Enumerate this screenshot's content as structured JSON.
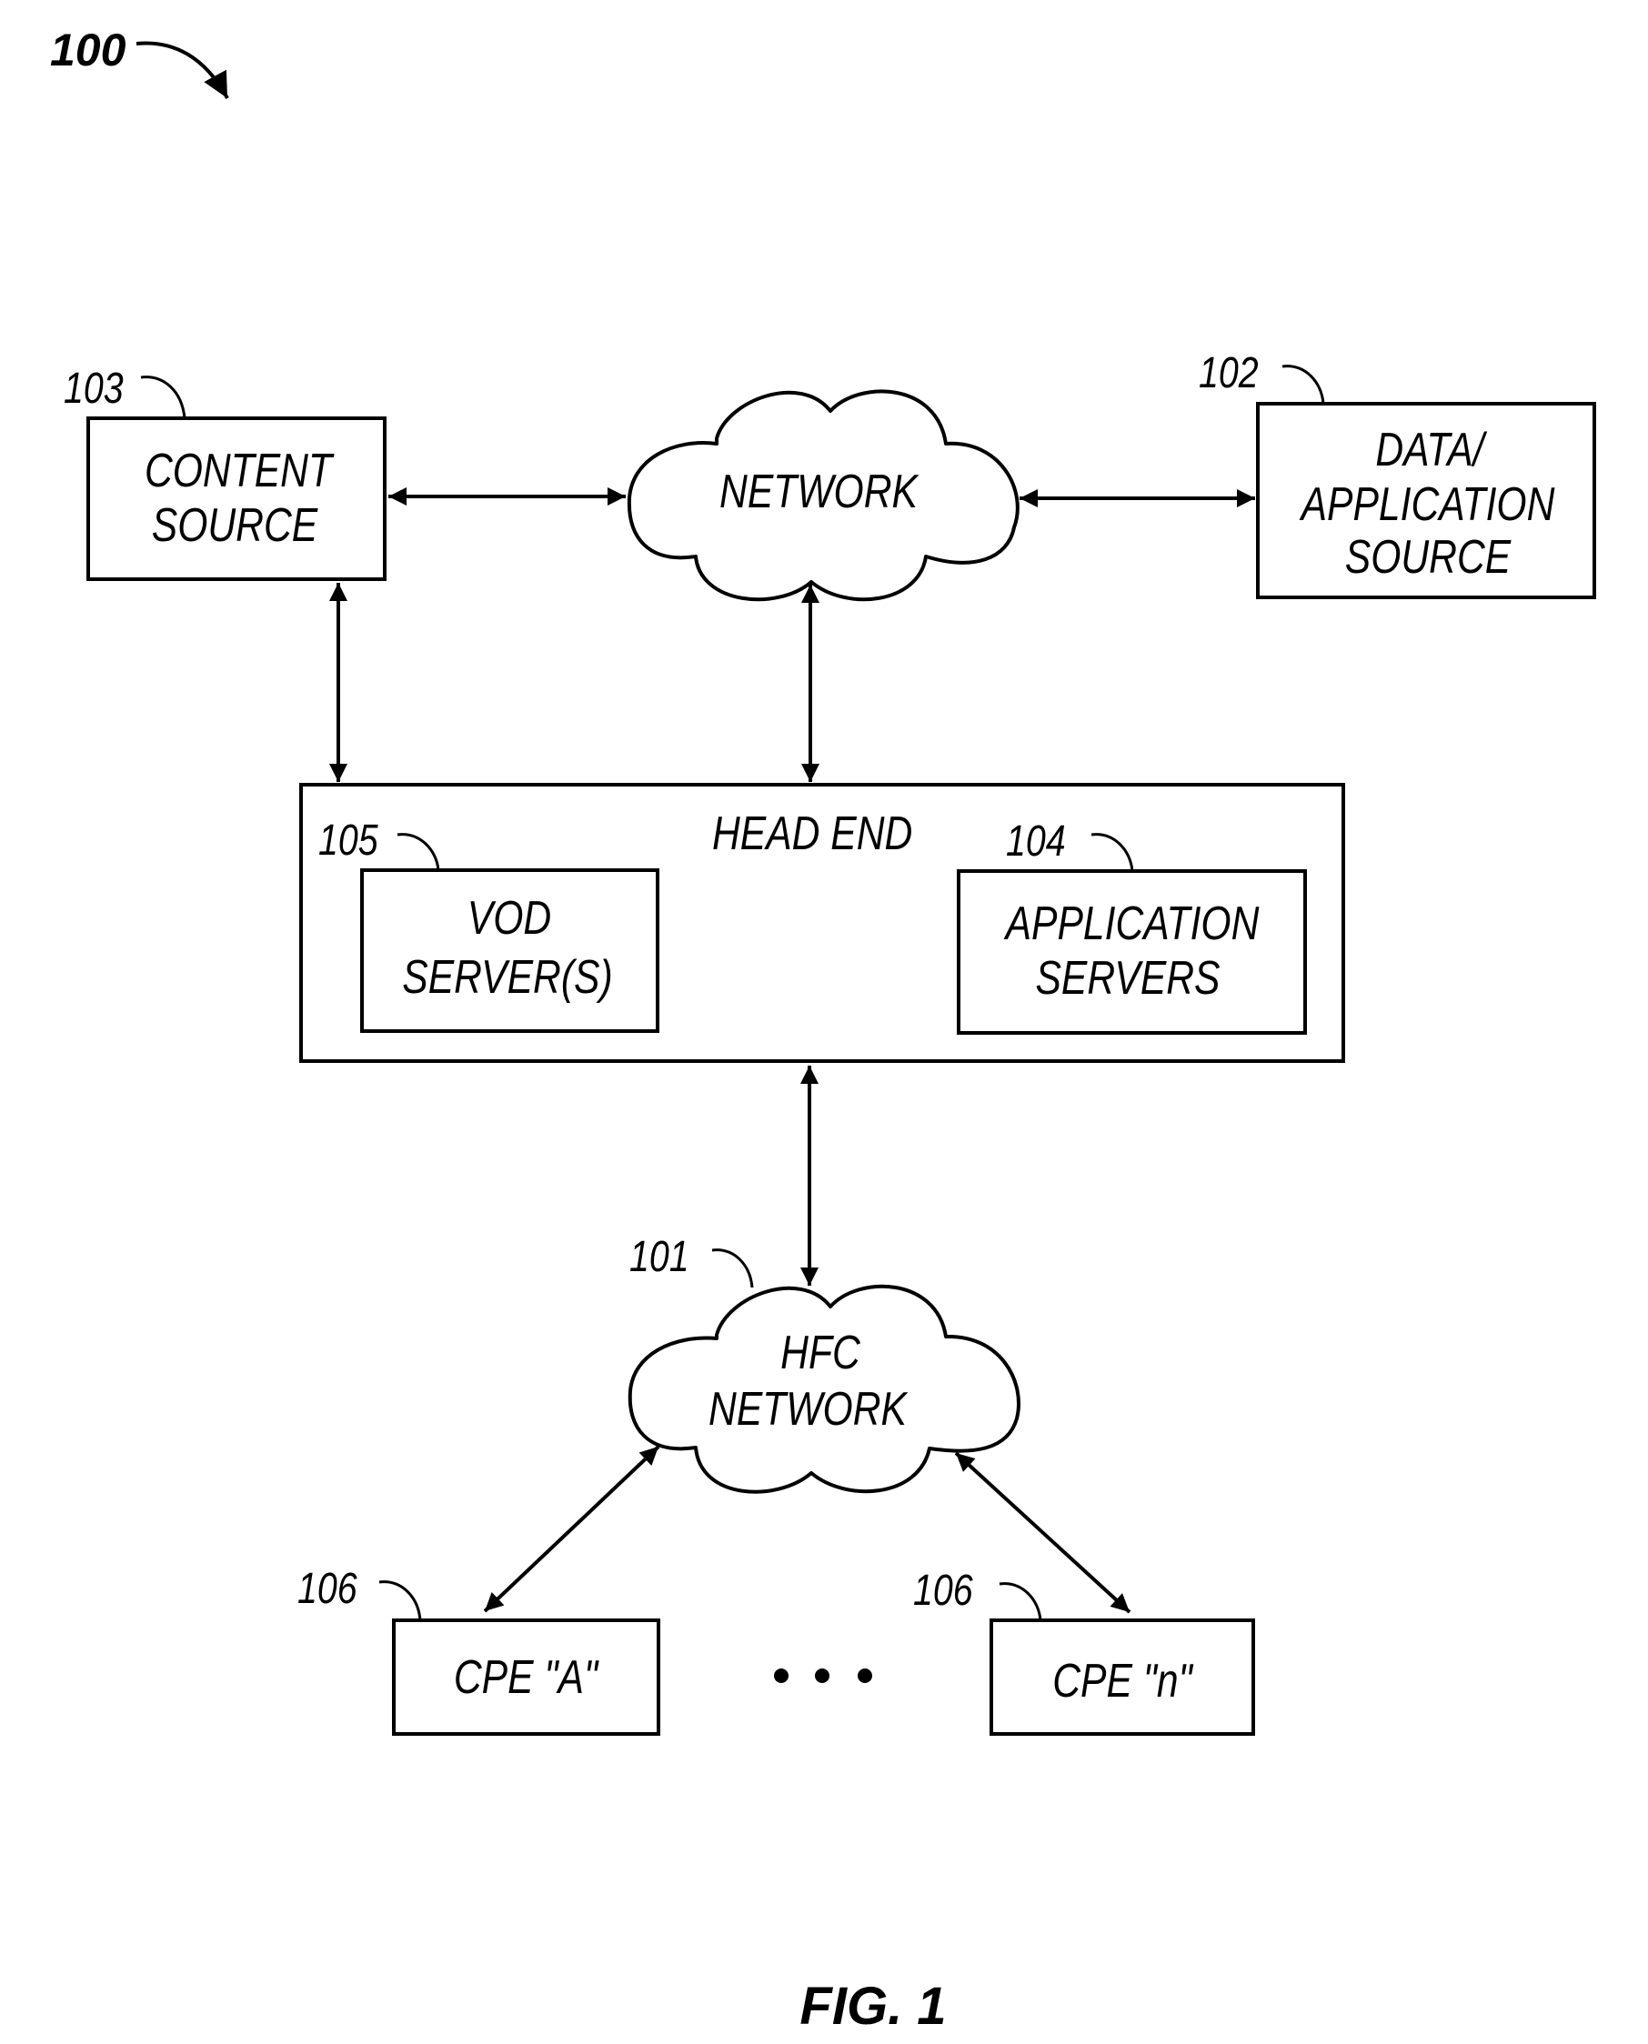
{
  "figure": {
    "ref": "100",
    "caption": "FIG. 1"
  },
  "nodes": {
    "content_source": {
      "ref": "103",
      "lines": [
        "CONTENT",
        "SOURCE"
      ]
    },
    "network": {
      "lines": [
        "NETWORK"
      ]
    },
    "data_app_source": {
      "ref": "102",
      "lines": [
        "DATA/",
        "APPLICATION",
        "SOURCE"
      ]
    },
    "head_end": {
      "label": "HEAD END"
    },
    "vod_servers": {
      "ref": "105",
      "lines": [
        "VOD",
        "SERVER(S)"
      ]
    },
    "app_servers": {
      "ref": "104",
      "lines": [
        "APPLICATION",
        "SERVERS"
      ]
    },
    "hfc_network": {
      "ref": "101",
      "lines": [
        "HFC",
        "NETWORK"
      ]
    },
    "cpe_a": {
      "ref": "106",
      "label": "CPE \"A\""
    },
    "cpe_n": {
      "ref": "106",
      "label": "CPE \"n\""
    },
    "ellipsis": "• • •"
  },
  "connections": [
    {
      "from": "content_source",
      "to": "network",
      "type": "bidirectional"
    },
    {
      "from": "network",
      "to": "data_app_source",
      "type": "bidirectional"
    },
    {
      "from": "content_source",
      "to": "head_end",
      "type": "bidirectional"
    },
    {
      "from": "network",
      "to": "head_end",
      "type": "bidirectional"
    },
    {
      "from": "head_end",
      "to": "hfc_network",
      "type": "bidirectional"
    },
    {
      "from": "hfc_network",
      "to": "cpe_a",
      "type": "bidirectional"
    },
    {
      "from": "hfc_network",
      "to": "cpe_n",
      "type": "bidirectional"
    }
  ]
}
